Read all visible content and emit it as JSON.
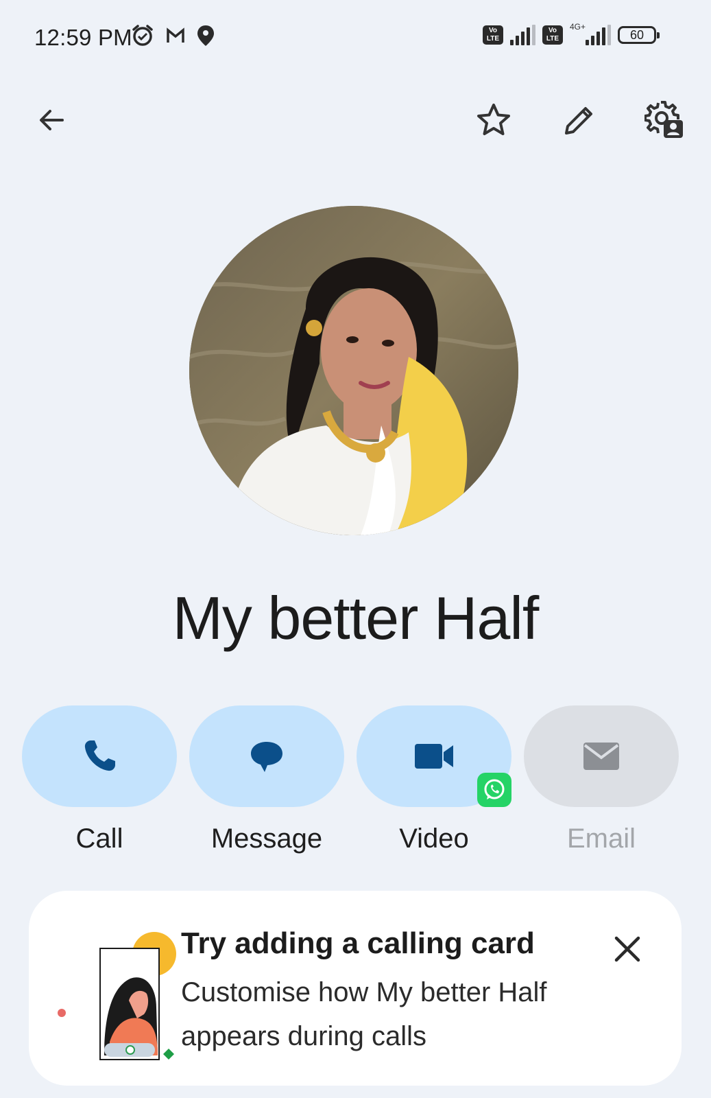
{
  "status_bar": {
    "time": "12:59 PM",
    "left_icons": [
      "alarm-icon",
      "gmail-icon",
      "location-icon"
    ],
    "sim1": "Vo LTE",
    "sim2": "Vo LTE",
    "network": "4G+",
    "battery": "60"
  },
  "top_bar": {
    "icons": [
      "back-arrow-icon",
      "star-icon",
      "edit-icon",
      "contact-settings-icon"
    ]
  },
  "contact": {
    "name": "My better Half"
  },
  "actions": [
    {
      "label": "Call",
      "icon": "phone-icon",
      "enabled": true
    },
    {
      "label": "Message",
      "icon": "message-icon",
      "enabled": true
    },
    {
      "label": "Video",
      "icon": "video-icon",
      "enabled": true,
      "badge": "whatsapp-icon"
    },
    {
      "label": "Email",
      "icon": "email-icon",
      "enabled": false
    }
  ],
  "calling_card": {
    "title": "Try adding a calling card",
    "text": "Customise how My better Half appears during calls"
  },
  "colors": {
    "background": "#eef2f8",
    "action_pill": "#c4e3fd",
    "action_icon": "#0b4f8a",
    "disabled_pill": "#dcdfe4",
    "whatsapp": "#25d366"
  }
}
